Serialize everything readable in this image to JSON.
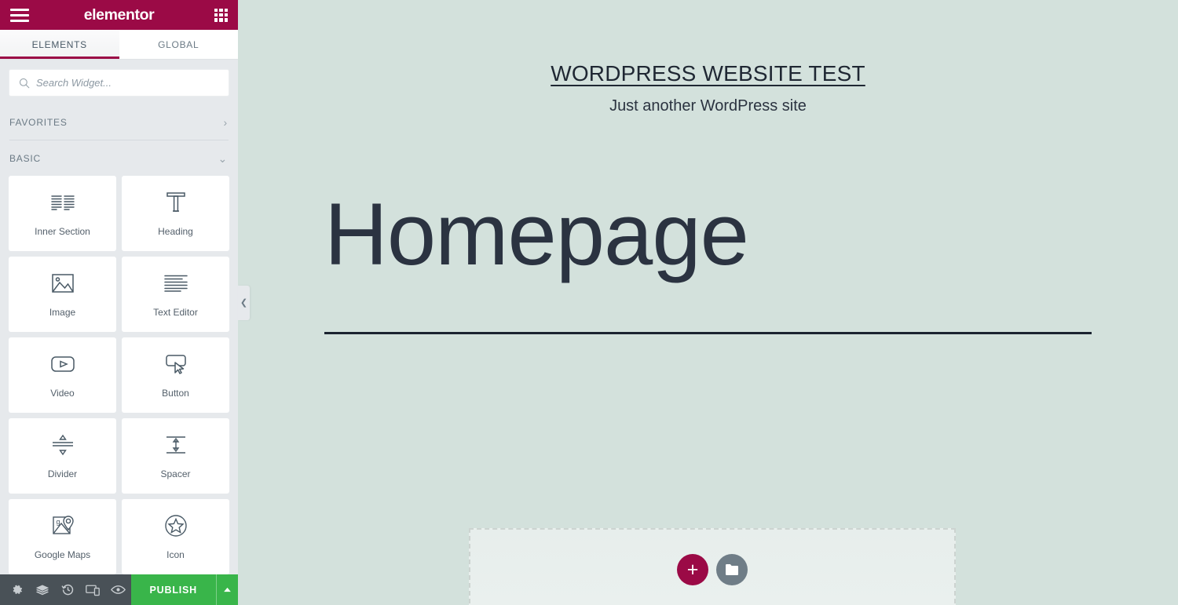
{
  "panel": {
    "brand": "elementor",
    "menu_icon": "hamburger-icon",
    "apps_icon": "grid-apps-icon",
    "tabs": [
      {
        "label": "ELEMENTS",
        "active": true
      },
      {
        "label": "GLOBAL",
        "active": false
      }
    ],
    "search": {
      "placeholder": "Search Widget...",
      "value": "",
      "icon": "search-icon"
    },
    "categories": [
      {
        "label": "FAVORITES",
        "state": "collapsed",
        "chevron": "›"
      },
      {
        "label": "BASIC",
        "state": "expanded",
        "chevron": "⌄"
      }
    ],
    "widgets": [
      {
        "label": "Inner Section",
        "icon": "inner-section-icon"
      },
      {
        "label": "Heading",
        "icon": "heading-t-icon"
      },
      {
        "label": "Image",
        "icon": "image-icon"
      },
      {
        "label": "Text Editor",
        "icon": "text-editor-icon"
      },
      {
        "label": "Video",
        "icon": "video-play-icon"
      },
      {
        "label": "Button",
        "icon": "button-cursor-icon"
      },
      {
        "label": "Divider",
        "icon": "divider-icon"
      },
      {
        "label": "Spacer",
        "icon": "spacer-icon"
      },
      {
        "label": "Google Maps",
        "icon": "google-maps-icon"
      },
      {
        "label": "Icon",
        "icon": "star-circle-icon"
      }
    ],
    "collapse_handle": {
      "icon": "chevron-left-icon",
      "glyph": "❮"
    }
  },
  "footer": {
    "buttons": [
      {
        "name": "settings",
        "icon": "gear-icon"
      },
      {
        "name": "navigator",
        "icon": "layers-icon"
      },
      {
        "name": "history",
        "icon": "history-clock-icon"
      },
      {
        "name": "responsive-mode",
        "icon": "responsive-devices-icon"
      },
      {
        "name": "preview",
        "icon": "eye-icon"
      }
    ],
    "publish_label": "PUBLISH",
    "publish_caret_icon": "caret-up-icon"
  },
  "canvas": {
    "site_title": "WORDPRESS WEBSITE TEST",
    "site_tagline": "Just another WordPress site",
    "page_heading": "Homepage",
    "add_section": {
      "add_icon": "plus-icon",
      "add_glyph": "+",
      "template_icon": "folder-icon"
    }
  },
  "colors": {
    "brand_red": "#9b0a46",
    "publish_green": "#39b54a",
    "panel_bg": "#e6e9ec",
    "footer_bg": "#495157",
    "canvas_bg": "#d3e1dc",
    "heading_text": "#2b3341"
  }
}
